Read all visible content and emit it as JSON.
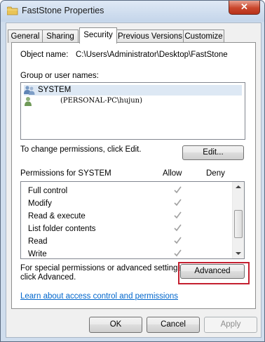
{
  "window": {
    "title": "FastStone Properties",
    "close_label": "✕"
  },
  "tabs": [
    {
      "label": "General"
    },
    {
      "label": "Sharing"
    },
    {
      "label": "Security"
    },
    {
      "label": "Previous Versions"
    },
    {
      "label": "Customize"
    }
  ],
  "security": {
    "object_name_label": "Object name:",
    "object_name_value": "C:\\Users\\Administrator\\Desktop\\FastStone",
    "group_label": "Group or user names:",
    "users": [
      {
        "name": "SYSTEM"
      },
      {
        "name": "(PERSONAL-PC\\hujun)"
      }
    ],
    "change_text": "To change permissions, click Edit.",
    "edit_button": "Edit...",
    "permissions_header": "Permissions for SYSTEM",
    "allow_header": "Allow",
    "deny_header": "Deny",
    "permissions": [
      {
        "name": "Full control",
        "allow": true,
        "deny": false
      },
      {
        "name": "Modify",
        "allow": true,
        "deny": false
      },
      {
        "name": "Read & execute",
        "allow": true,
        "deny": false
      },
      {
        "name": "List folder contents",
        "allow": true,
        "deny": false
      },
      {
        "name": "Read",
        "allow": true,
        "deny": false
      },
      {
        "name": "Write",
        "allow": true,
        "deny": false
      }
    ],
    "special_text_line1": "For special permissions or advanced settings,",
    "special_text_line2": "click Advanced.",
    "advanced_button": "Advanced",
    "learn_link": "Learn about access control and permissions"
  },
  "footer": {
    "ok": "OK",
    "cancel": "Cancel",
    "apply": "Apply"
  },
  "colors": {
    "link": "#0066cc",
    "highlight_border": "#c42030",
    "check_gray": "#a0a0a0"
  }
}
